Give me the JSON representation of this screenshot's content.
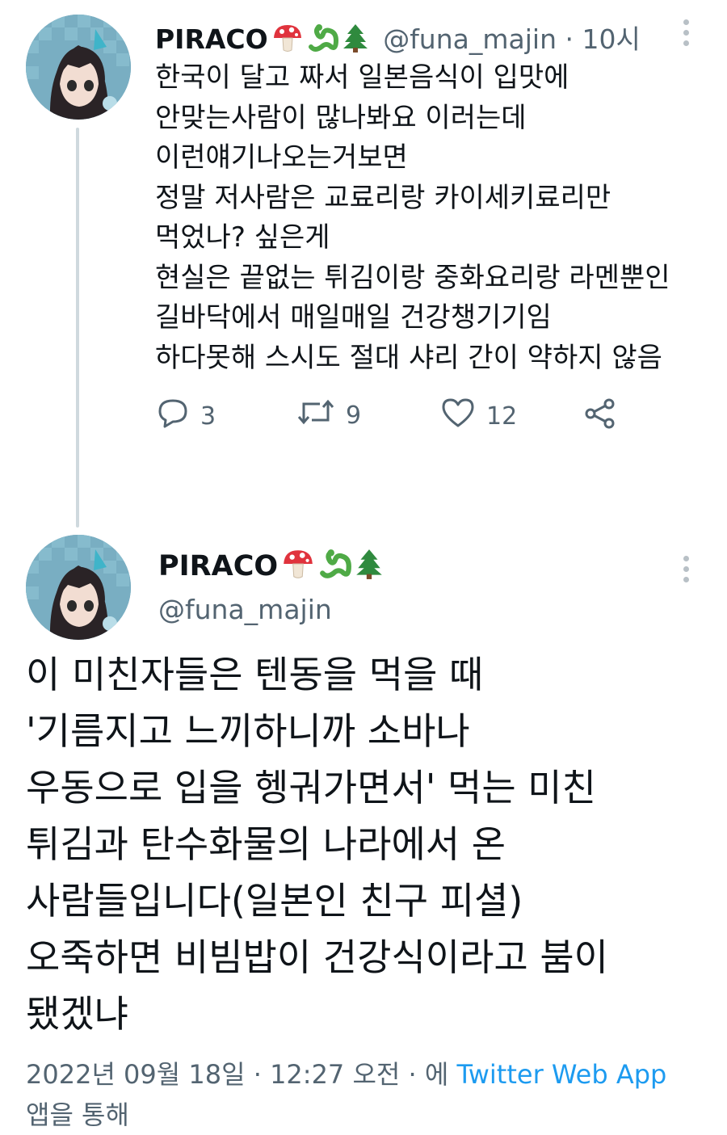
{
  "reply_tweet": {
    "display_name": "PIRACO",
    "handle": "@funa_majin",
    "time": "10시",
    "lines": [
      "한국이 달고 짜서 일본음식이 입맛에",
      "안맞는사람이 많나봐요 이러는데",
      "이런얘기나오는거보면",
      "정말 저사람은 교료리랑 카이세키료리만",
      "먹었나? 싶은게",
      "현실은 끝없는 튀김이랑 중화요리랑 라멘뿐인",
      "길바닥에서 매일매일 건강챙기기임",
      "하다못해 스시도 절대 샤리 간이 약하지 않음"
    ],
    "reply_count": "3",
    "retweet_count": "9",
    "like_count": "12"
  },
  "main_tweet": {
    "display_name": "PIRACO",
    "handle": "@funa_majin",
    "lines": [
      "이 미친자들은 텐동을 먹을 때",
      "'기름지고 느끼하니까 소바나",
      "우동으로 입을 헹궈가면서' 먹는 미친",
      "튀김과 탄수화물의 나라에서 온",
      "사람들입니다(일본인 친구 피셜)",
      "오죽하면 비빔밥이 건강식이라고 붐이",
      "됐겠냐"
    ],
    "date": "2022년 09월 18일",
    "time": "12:27 오전",
    "via_prefix": "에",
    "source": "Twitter Web App",
    "via_suffix": "앱을 통해"
  },
  "icons": [
    "mushroom-icon",
    "snake-icon",
    "tree-icon",
    "more-icon",
    "reply-icon",
    "retweet-icon",
    "like-icon",
    "share-icon"
  ],
  "colors": {
    "text": "#0f1419",
    "muted": "#536471",
    "link": "#1d9bf0",
    "thread_line": "#cfd9de"
  }
}
